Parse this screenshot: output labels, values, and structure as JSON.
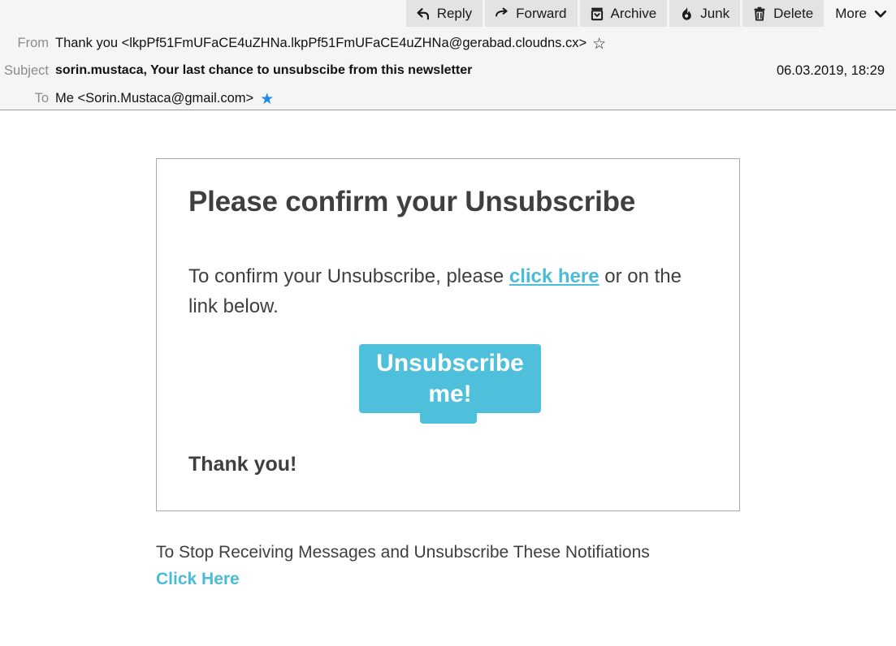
{
  "toolbar": {
    "buttons": [
      {
        "label": "Reply",
        "icon": "reply-icon"
      },
      {
        "label": "Forward",
        "icon": "forward-icon"
      },
      {
        "label": "Archive",
        "icon": "archive-icon"
      },
      {
        "label": "Junk",
        "icon": "junk-icon"
      },
      {
        "label": "Delete",
        "icon": "trash-icon"
      },
      {
        "label": "More",
        "icon": "chevron-down-icon"
      }
    ]
  },
  "headers": {
    "from_label": "From",
    "from_value": "Thank you <lkpPf51FmUFaCE4uZHNa.lkpPf51FmUFaCE4uZHNa@gerabad.cloudns.cx>",
    "from_star": "☆",
    "subject_label": "Subject",
    "subject_value": "sorin.mustaca, Your last chance to unsubscibe from this newsletter",
    "date": "06.03.2019, 18:29",
    "to_label": "To",
    "to_value": "Me <Sorin.Mustaca@gmail.com>",
    "to_star": "★"
  },
  "message": {
    "title": "Please confirm your Unsubscribe",
    "paragraph_before": "To confirm your Unsubscribe, please ",
    "paragraph_link": "click here",
    "paragraph_after": " or on the link below.",
    "button_text": "Unsubscribe me!",
    "thanks": "Thank you!"
  },
  "footer": {
    "text": "To Stop Receiving Messages and Unsubscribe These Notifiations",
    "link": "Click Here"
  },
  "colors": {
    "accent_cyan": "#4fc0dc",
    "link_cyan": "#4bbcd8",
    "header_bg": "#f5f5f5",
    "toolbar_btn": "#e3e3e3",
    "star_blue": "#1f8ceb",
    "text_dark": "#3f3f3f"
  }
}
